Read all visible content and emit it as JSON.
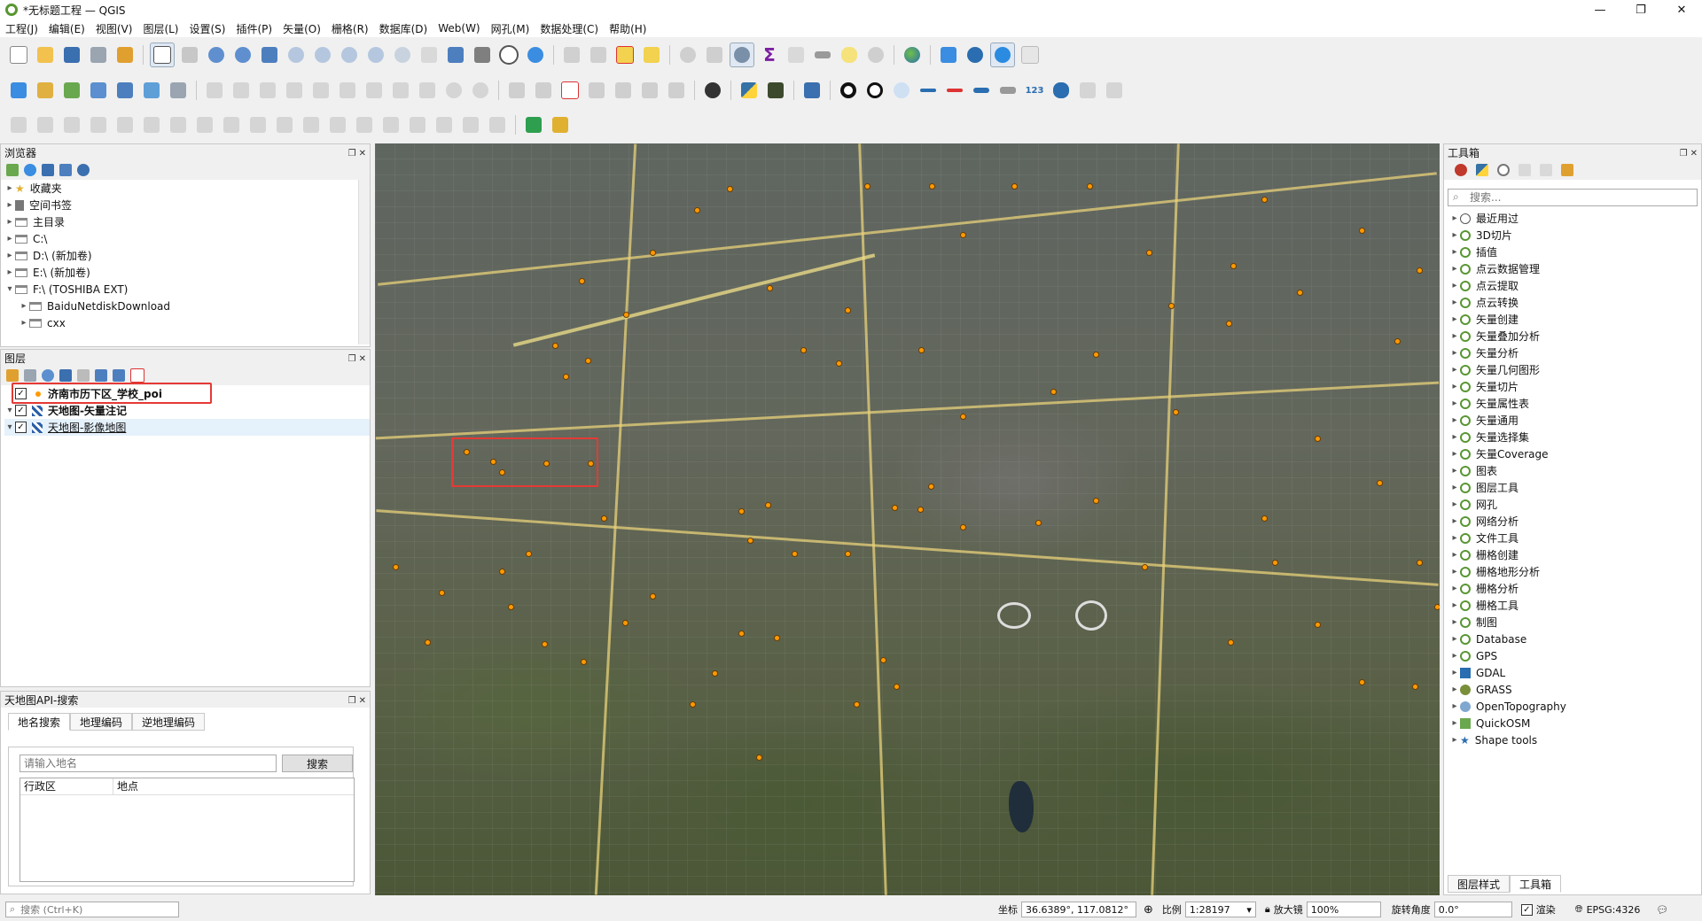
{
  "window": {
    "title": "*无标题工程 — QGIS",
    "minimize": "—",
    "maximize": "❐",
    "close": "✕"
  },
  "menu": [
    "工程(J)",
    "编辑(E)",
    "视图(V)",
    "图层(L)",
    "设置(S)",
    "插件(P)",
    "矢量(O)",
    "栅格(R)",
    "数据库(D)",
    "Web(W)",
    "网孔(M)",
    "数据处理(C)",
    "帮助(H)"
  ],
  "browser": {
    "title": "浏览器",
    "items": [
      {
        "label": "收藏夹",
        "indent": 0,
        "expand": "▸"
      },
      {
        "label": "空间书签",
        "indent": 0,
        "expand": "▸"
      },
      {
        "label": "主目录",
        "indent": 0,
        "expand": "▸"
      },
      {
        "label": "C:\\",
        "indent": 0,
        "expand": "▸"
      },
      {
        "label": "D:\\ (新加卷)",
        "indent": 0,
        "expand": "▸"
      },
      {
        "label": "E:\\ (新加卷)",
        "indent": 0,
        "expand": "▸"
      },
      {
        "label": "F:\\ (TOSHIBA EXT)",
        "indent": 0,
        "expand": "▾"
      },
      {
        "label": "BaiduNetdiskDownload",
        "indent": 1,
        "expand": "▸"
      },
      {
        "label": "cxx",
        "indent": 1,
        "expand": "▸"
      }
    ]
  },
  "layers": {
    "title": "图层",
    "items": [
      {
        "label": "济南市历下区_学校_poi",
        "checked": "✓"
      },
      {
        "label": "天地图-矢量注记",
        "checked": "✓"
      },
      {
        "label": "天地图-影像地图",
        "checked": "✓"
      }
    ]
  },
  "search_panel": {
    "title": "天地图API-搜索",
    "tabs": [
      "地名搜索",
      "地理编码",
      "逆地理编码"
    ],
    "placeholder": "请输入地名",
    "search_button": "搜索",
    "columns": [
      "行政区",
      "地点"
    ]
  },
  "toolbox": {
    "title": "工具箱",
    "search_placeholder": "搜索...",
    "items": [
      "最近用过",
      "3D切片",
      "插值",
      "点云数据管理",
      "点云提取",
      "点云转换",
      "矢量创建",
      "矢量叠加分析",
      "矢量分析",
      "矢量几何图形",
      "矢量切片",
      "矢量属性表",
      "矢量通用",
      "矢量选择集",
      "矢量Coverage",
      "图表",
      "图层工具",
      "网孔",
      "网络分析",
      "文件工具",
      "栅格创建",
      "栅格地形分析",
      "栅格分析",
      "栅格工具",
      "制图",
      "Database",
      "GPS",
      "GDAL",
      "GRASS",
      "OpenTopography",
      "QuickOSM",
      "Shape tools"
    ],
    "bottom_tabs": [
      "图层样式",
      "工具箱"
    ]
  },
  "statusbar": {
    "locator_placeholder": "搜索 (Ctrl+K)",
    "coord_label": "坐标",
    "coord_value": "36.6389°, 117.0812°",
    "scale_label": "比例",
    "scale_value": "1:28197",
    "magnifier_label": "放大镜",
    "magnifier_value": "100%",
    "rotation_label": "旋转角度",
    "rotation_value": "0.0°",
    "render_label": "渲染",
    "crs": "EPSG:4326"
  },
  "colors": {
    "accent": "#589632",
    "poi": "#ff9a00",
    "highlight": "#e53935"
  }
}
